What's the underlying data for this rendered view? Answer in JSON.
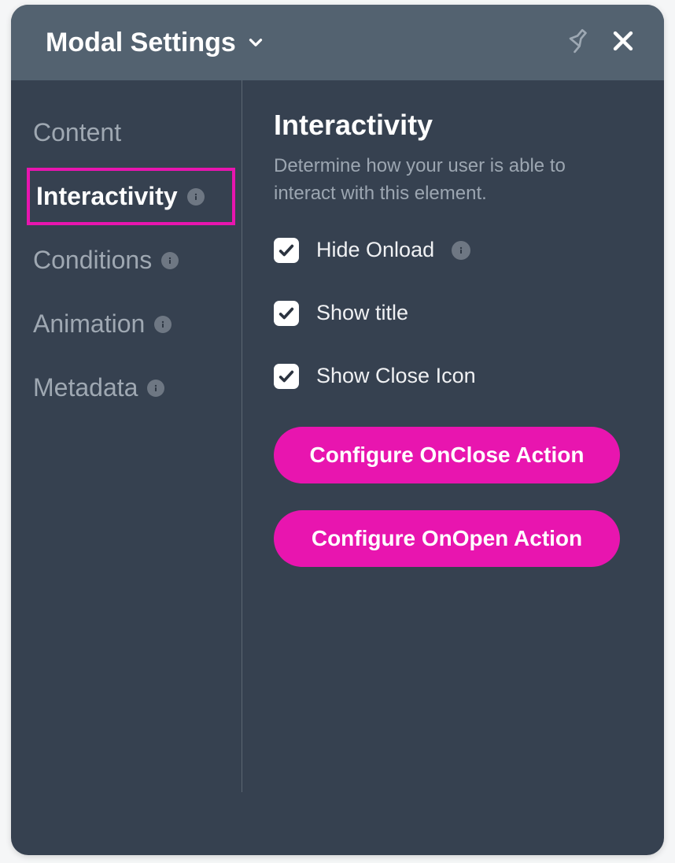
{
  "header": {
    "title": "Modal Settings"
  },
  "sidebar": {
    "items": [
      {
        "label": "Content",
        "info": false,
        "active": false
      },
      {
        "label": "Interactivity",
        "info": true,
        "active": true
      },
      {
        "label": "Conditions",
        "info": true,
        "active": false
      },
      {
        "label": "Animation",
        "info": true,
        "active": false
      },
      {
        "label": "Metadata",
        "info": true,
        "active": false
      }
    ]
  },
  "main": {
    "title": "Interactivity",
    "description": "Determine how your user is able to interact with this element.",
    "checkboxes": [
      {
        "label": "Hide Onload",
        "checked": true,
        "info": true
      },
      {
        "label": "Show title",
        "checked": true,
        "info": false
      },
      {
        "label": "Show Close Icon",
        "checked": true,
        "info": false
      }
    ],
    "buttons": [
      {
        "label": "Configure OnClose Action"
      },
      {
        "label": "Configure OnOpen Action"
      }
    ]
  },
  "colors": {
    "accent": "#e815af",
    "panel": "#364150",
    "header": "#536270"
  }
}
